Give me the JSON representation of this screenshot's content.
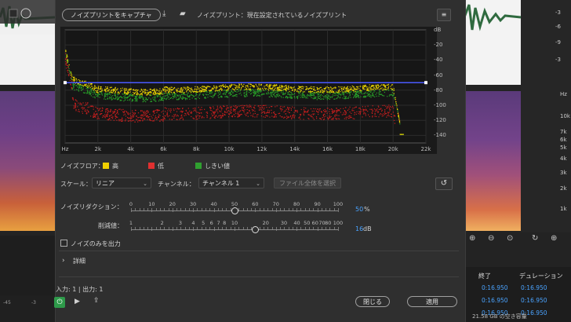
{
  "background": {
    "left_ruler": [
      "-45",
      "-3"
    ],
    "right_db_scale": [
      "-3",
      "-6",
      "-9",
      "-3"
    ],
    "right_hz_scale": [
      "Hz",
      "10k",
      "7k",
      "6k",
      "5k",
      "4k",
      "3k",
      "2k",
      "1k"
    ],
    "table_headers": [
      "終了",
      "デュレーション"
    ],
    "table_rows": [
      [
        "0:16.950",
        "0:16.950"
      ],
      [
        "0:16.950",
        "0:16.950"
      ],
      [
        "0:16.950",
        "0:16.950"
      ]
    ],
    "storage_text": "21.58 GB の空き容量"
  },
  "dialog": {
    "capture_button": "ノイズプリントをキャプチャ",
    "noiseprint_label": "ノイズプリント：現在設定されているノイズプリント",
    "graph": {
      "db_ticks": [
        "dB",
        "-20",
        "-40",
        "-60",
        "-80",
        "-100",
        "-120",
        "-140"
      ],
      "x_ticks": [
        "Hz",
        "2k",
        "4k",
        "6k",
        "8k",
        "10k",
        "12k",
        "14k",
        "16k",
        "18k",
        "20k",
        "22k"
      ],
      "threshold_db": -70
    },
    "legend": {
      "label": "ノイズフロア：",
      "items": [
        {
          "label": "高",
          "color": "#f0d000"
        },
        {
          "label": "低",
          "color": "#e03030"
        },
        {
          "label": "しきい値",
          "color": "#30a030"
        }
      ]
    },
    "scale_label": "スケール：",
    "scale_value": "リニア",
    "channel_label": "チャンネル：",
    "channel_value": "チャンネル 1",
    "select_file_button": "ファイル全体を選択",
    "reduction": {
      "label": "ノイズリダクション：",
      "ticks": [
        "0",
        "10",
        "20",
        "30",
        "40",
        "50",
        "60",
        "70",
        "80",
        "90",
        "100"
      ],
      "value": "50",
      "unit": "%",
      "fraction": 0.5
    },
    "reduce_by": {
      "label": "削減値：",
      "ticks": [
        "1",
        "2",
        "3",
        "4",
        "5",
        "6",
        "7",
        "8",
        "10",
        "20",
        "30",
        "40",
        "50",
        "60",
        "70",
        "80",
        "100"
      ],
      "value": "16",
      "unit": "dB",
      "fraction": 0.6
    },
    "output_noise_only": "ノイズのみを出力",
    "advanced": "詳細",
    "io_label": "入力: 1 | 出力: 1",
    "close_button": "閉じる",
    "apply_button": "適用"
  }
}
